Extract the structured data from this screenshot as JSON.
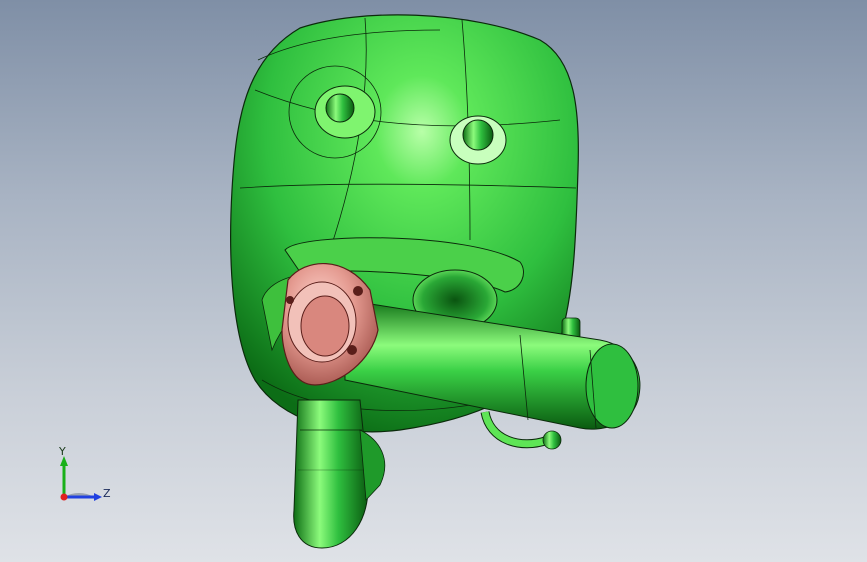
{
  "viewport": {
    "background_top": "#7f8fa6",
    "background_bottom": "#dfe2e7"
  },
  "model": {
    "body_color": "#2fbf3f",
    "body_highlight": "#9dff8a",
    "body_shadow": "#0a6a12",
    "flange_color": "#e7a39a",
    "flange_shadow": "#b0605a",
    "edge_color": "#0b2a0b"
  },
  "triad": {
    "y_label": "Y",
    "z_label": "Z",
    "x_color": "#e02020",
    "y_color": "#19b019",
    "z_color": "#2040e0"
  }
}
